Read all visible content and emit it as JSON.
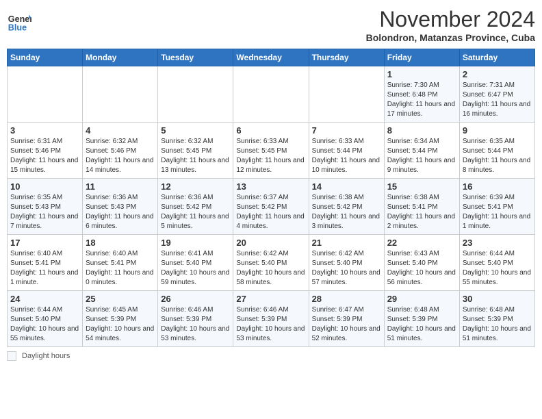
{
  "header": {
    "logo_line1": "General",
    "logo_line2": "Blue",
    "month": "November 2024",
    "location": "Bolondron, Matanzas Province, Cuba"
  },
  "weekdays": [
    "Sunday",
    "Monday",
    "Tuesday",
    "Wednesday",
    "Thursday",
    "Friday",
    "Saturday"
  ],
  "weeks": [
    [
      {
        "day": "",
        "info": ""
      },
      {
        "day": "",
        "info": ""
      },
      {
        "day": "",
        "info": ""
      },
      {
        "day": "",
        "info": ""
      },
      {
        "day": "",
        "info": ""
      },
      {
        "day": "1",
        "info": "Sunrise: 7:30 AM\nSunset: 6:48 PM\nDaylight: 11 hours and 17 minutes."
      },
      {
        "day": "2",
        "info": "Sunrise: 7:31 AM\nSunset: 6:47 PM\nDaylight: 11 hours and 16 minutes."
      }
    ],
    [
      {
        "day": "3",
        "info": "Sunrise: 6:31 AM\nSunset: 5:46 PM\nDaylight: 11 hours and 15 minutes."
      },
      {
        "day": "4",
        "info": "Sunrise: 6:32 AM\nSunset: 5:46 PM\nDaylight: 11 hours and 14 minutes."
      },
      {
        "day": "5",
        "info": "Sunrise: 6:32 AM\nSunset: 5:45 PM\nDaylight: 11 hours and 13 minutes."
      },
      {
        "day": "6",
        "info": "Sunrise: 6:33 AM\nSunset: 5:45 PM\nDaylight: 11 hours and 12 minutes."
      },
      {
        "day": "7",
        "info": "Sunrise: 6:33 AM\nSunset: 5:44 PM\nDaylight: 11 hours and 10 minutes."
      },
      {
        "day": "8",
        "info": "Sunrise: 6:34 AM\nSunset: 5:44 PM\nDaylight: 11 hours and 9 minutes."
      },
      {
        "day": "9",
        "info": "Sunrise: 6:35 AM\nSunset: 5:44 PM\nDaylight: 11 hours and 8 minutes."
      }
    ],
    [
      {
        "day": "10",
        "info": "Sunrise: 6:35 AM\nSunset: 5:43 PM\nDaylight: 11 hours and 7 minutes."
      },
      {
        "day": "11",
        "info": "Sunrise: 6:36 AM\nSunset: 5:43 PM\nDaylight: 11 hours and 6 minutes."
      },
      {
        "day": "12",
        "info": "Sunrise: 6:36 AM\nSunset: 5:42 PM\nDaylight: 11 hours and 5 minutes."
      },
      {
        "day": "13",
        "info": "Sunrise: 6:37 AM\nSunset: 5:42 PM\nDaylight: 11 hours and 4 minutes."
      },
      {
        "day": "14",
        "info": "Sunrise: 6:38 AM\nSunset: 5:42 PM\nDaylight: 11 hours and 3 minutes."
      },
      {
        "day": "15",
        "info": "Sunrise: 6:38 AM\nSunset: 5:41 PM\nDaylight: 11 hours and 2 minutes."
      },
      {
        "day": "16",
        "info": "Sunrise: 6:39 AM\nSunset: 5:41 PM\nDaylight: 11 hours and 1 minute."
      }
    ],
    [
      {
        "day": "17",
        "info": "Sunrise: 6:40 AM\nSunset: 5:41 PM\nDaylight: 11 hours and 1 minute."
      },
      {
        "day": "18",
        "info": "Sunrise: 6:40 AM\nSunset: 5:41 PM\nDaylight: 11 hours and 0 minutes."
      },
      {
        "day": "19",
        "info": "Sunrise: 6:41 AM\nSunset: 5:40 PM\nDaylight: 10 hours and 59 minutes."
      },
      {
        "day": "20",
        "info": "Sunrise: 6:42 AM\nSunset: 5:40 PM\nDaylight: 10 hours and 58 minutes."
      },
      {
        "day": "21",
        "info": "Sunrise: 6:42 AM\nSunset: 5:40 PM\nDaylight: 10 hours and 57 minutes."
      },
      {
        "day": "22",
        "info": "Sunrise: 6:43 AM\nSunset: 5:40 PM\nDaylight: 10 hours and 56 minutes."
      },
      {
        "day": "23",
        "info": "Sunrise: 6:44 AM\nSunset: 5:40 PM\nDaylight: 10 hours and 55 minutes."
      }
    ],
    [
      {
        "day": "24",
        "info": "Sunrise: 6:44 AM\nSunset: 5:40 PM\nDaylight: 10 hours and 55 minutes."
      },
      {
        "day": "25",
        "info": "Sunrise: 6:45 AM\nSunset: 5:39 PM\nDaylight: 10 hours and 54 minutes."
      },
      {
        "day": "26",
        "info": "Sunrise: 6:46 AM\nSunset: 5:39 PM\nDaylight: 10 hours and 53 minutes."
      },
      {
        "day": "27",
        "info": "Sunrise: 6:46 AM\nSunset: 5:39 PM\nDaylight: 10 hours and 53 minutes."
      },
      {
        "day": "28",
        "info": "Sunrise: 6:47 AM\nSunset: 5:39 PM\nDaylight: 10 hours and 52 minutes."
      },
      {
        "day": "29",
        "info": "Sunrise: 6:48 AM\nSunset: 5:39 PM\nDaylight: 10 hours and 51 minutes."
      },
      {
        "day": "30",
        "info": "Sunrise: 6:48 AM\nSunset: 5:39 PM\nDaylight: 10 hours and 51 minutes."
      }
    ]
  ],
  "footer": {
    "daylight_label": "Daylight hours"
  }
}
